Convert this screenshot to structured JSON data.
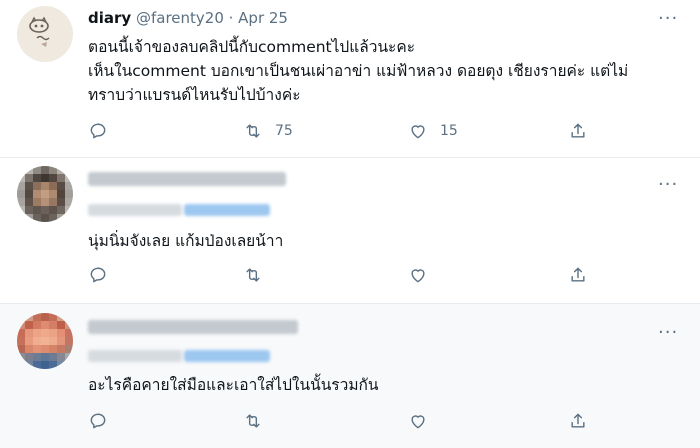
{
  "tweets": [
    {
      "name": "diary",
      "handle": "@farenty20 · Apr 25",
      "lines": [
        "ตอนนี้เจ้าของลบคลิปนี้กับcommentไปแล้วนะคะ",
        "เห็นในcomment บอกเขาเป็นชนเผ่าอาข่า แม่ฟ้าหลวง ดอยตุง เชียงรายค่ะ แต่ไม่",
        "ทราบว่าแบรนด์ไหนรับไปบ้างค่ะ"
      ],
      "retweets": "75",
      "likes": "15"
    },
    {
      "lines": [
        "นุ่มนิ่มจังเลย แก้มป่องเลยน้าา"
      ],
      "retweets": "",
      "likes": ""
    },
    {
      "lines": [
        "อะไรคือคายใส่มือและเอาใส่ไปในนั้นรวมกัน"
      ],
      "retweets": "",
      "likes": ""
    }
  ],
  "icons": {
    "more": "more-icon",
    "reply": "reply-icon",
    "retweet": "retweet-icon",
    "like": "heart-icon",
    "share": "share-icon"
  },
  "colors": {
    "text": "#0f1419",
    "secondary": "#5b7083",
    "divider": "#e6ecf0",
    "hover_bg": "#f7f9fa"
  }
}
